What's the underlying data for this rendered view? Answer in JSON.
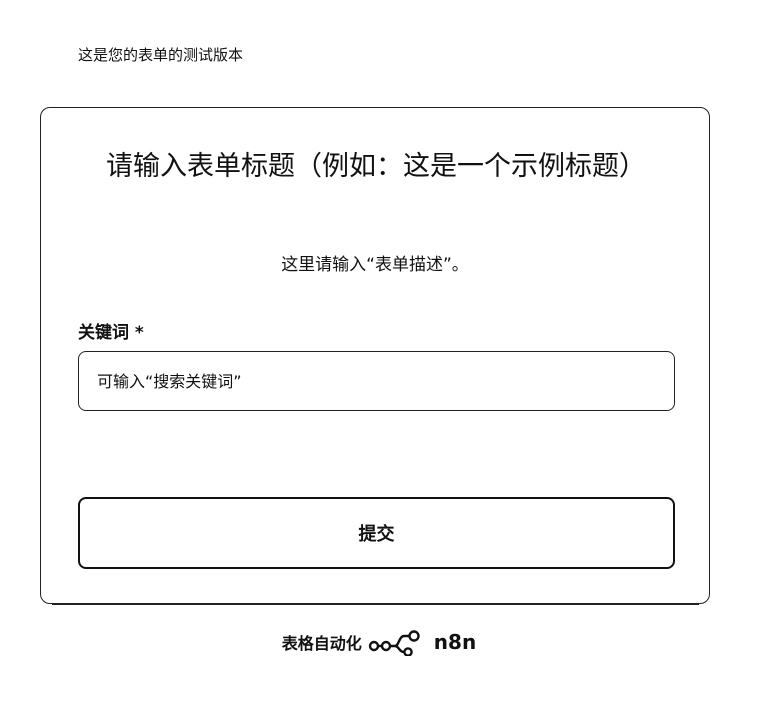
{
  "banner": {
    "text": "这是您的表单的测试版本"
  },
  "form": {
    "title": "请输入表单标题（例如：这是一个示例标题）",
    "description": "这里请输入“表单描述”。",
    "field": {
      "label": "关键词 *",
      "placeholder": "可输入“搜索关键词”",
      "value": ""
    },
    "submit_label": "提交"
  },
  "footer": {
    "text": "表格自动化",
    "brand": "n8n",
    "icon": "n8n-logo-icon"
  }
}
